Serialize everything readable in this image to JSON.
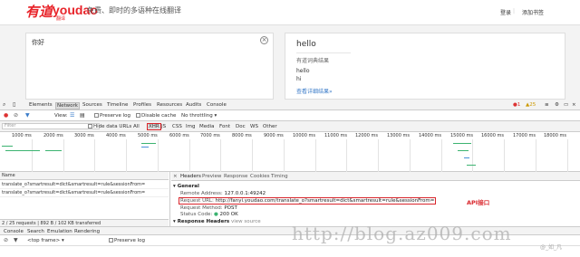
{
  "header": {
    "logo_cn": "有道",
    "logo_en": "youdao",
    "logo_sub": "翻译",
    "slogan": "免费、即时的多语种在线翻译",
    "login": "登录",
    "bookmark": "添加书签"
  },
  "translate": {
    "source_text": "你好",
    "result_title": "hello",
    "dict_label": "有道词典结果",
    "results": [
      "hello",
      "hi"
    ],
    "more_link": "查看详细结果»"
  },
  "devtools": {
    "tabs": [
      "Elements",
      "Network",
      "Sources",
      "Timeline",
      "Profiles",
      "Resources",
      "Audits",
      "Console"
    ],
    "active_tab": "Network",
    "error_count": "1",
    "warn_count": "25",
    "view_label": "View:",
    "preserve_log": "Preserve log",
    "disable_cache": "Disable cache",
    "throttle": "No throttling",
    "filter_placeholder": "Filter",
    "hide_data_urls": "Hide data URLs",
    "filter_types": [
      "All",
      "XHR",
      "JS",
      "CSS",
      "Img",
      "Media",
      "Font",
      "Doc",
      "WS",
      "Other"
    ],
    "timeline_ticks": [
      "1000 ms",
      "2000 ms",
      "3000 ms",
      "4000 ms",
      "5000 ms",
      "6000 ms",
      "7000 ms",
      "8000 ms",
      "9000 ms",
      "10000 ms",
      "11000 ms",
      "12000 ms",
      "13000 ms",
      "14000 ms",
      "15000 ms",
      "16000 ms",
      "17000 ms",
      "18000 ms"
    ],
    "name_header": "Name",
    "requests": [
      "translate_o?smartresult=dict&smartresult=rule&sessionFrom=",
      "translate_o?smartresult=dict&smartresult=rule&sessionFrom="
    ],
    "summary": "2 / 25 requests | 892 B / 102 KB transferred",
    "detail_tabs": [
      "Headers",
      "Preview",
      "Response",
      "Cookies",
      "Timing"
    ],
    "general_label": "General",
    "remote_label": "Remote Address:",
    "remote_value": "127.0.0.1:49242",
    "url_label": "Request URL:",
    "url_value": "http://fanyi.youdao.com/translate_o?smartresult=dict&smartresult=rule&sessionFrom=",
    "api_note": "API接口",
    "method_label": "Request Method:",
    "method_value": "POST",
    "status_label": "Status Code:",
    "status_value": "200 OK",
    "response_headers_label": "Response Headers",
    "view_source": "view source",
    "console_tabs": [
      "Console",
      "Search",
      "Emulation",
      "Rendering"
    ],
    "frame": "<top frame>",
    "console_preserve": "Preserve log"
  },
  "watermark": {
    "url": "http://blog.az009.com",
    "credit": "@_如_凡"
  },
  "colors": {
    "brand_red": "#e8242a",
    "link_blue": "#3b7cc9",
    "annotation_red": "#d9262c",
    "watermark_gray": "#b0b0b0"
  }
}
